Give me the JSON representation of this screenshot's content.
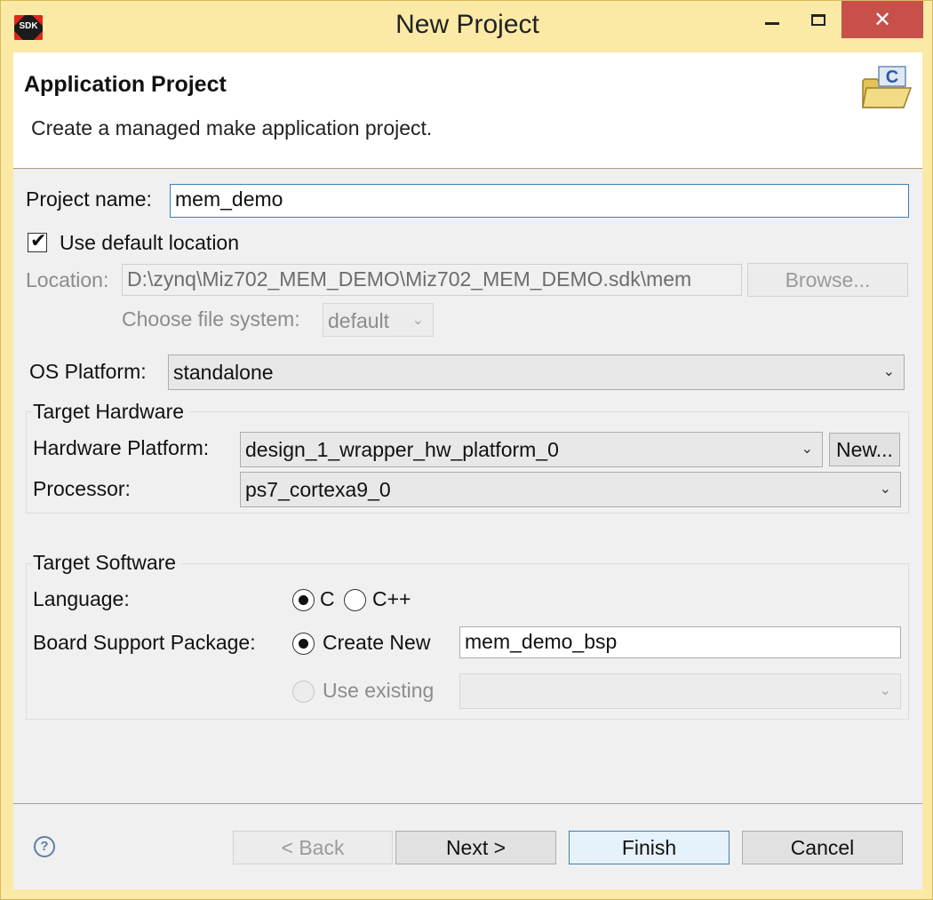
{
  "window": {
    "title": "New Project",
    "app_icon_label": "SDK",
    "close_glyph": "✕"
  },
  "banner": {
    "title": "Application Project",
    "description": "Create a managed make application project.",
    "icon": "folder-c-icon"
  },
  "form": {
    "project_name_label": "Project name:",
    "project_name_value": "mem_demo",
    "use_default_location_label": "Use default location",
    "use_default_location_checked": true,
    "location_label": "Location:",
    "location_value": "D:\\zynq\\Miz702_MEM_DEMO\\Miz702_MEM_DEMO.sdk\\mem",
    "browse_label": "Browse...",
    "file_system_label": "Choose file system:",
    "file_system_value": "default",
    "os_platform_label": "OS Platform:",
    "os_platform_value": "standalone"
  },
  "target_hardware": {
    "group_label": "Target Hardware",
    "hardware_platform_label": "Hardware Platform:",
    "hardware_platform_value": "design_1_wrapper_hw_platform_0",
    "new_button_label": "New...",
    "processor_label": "Processor:",
    "processor_value": "ps7_cortexa9_0"
  },
  "target_software": {
    "group_label": "Target Software",
    "language_label": "Language:",
    "language_options": [
      "C",
      "C++"
    ],
    "language_selected": "C",
    "bsp_label": "Board Support Package:",
    "create_new_label": "Create New",
    "bsp_name_value": "mem_demo_bsp",
    "use_existing_label": "Use existing",
    "bsp_selected": "Create New"
  },
  "footer": {
    "help_glyph": "?",
    "back_label": "< Back",
    "next_label": "Next >",
    "finish_label": "Finish",
    "cancel_label": "Cancel"
  },
  "chevron_glyph": "⌄"
}
